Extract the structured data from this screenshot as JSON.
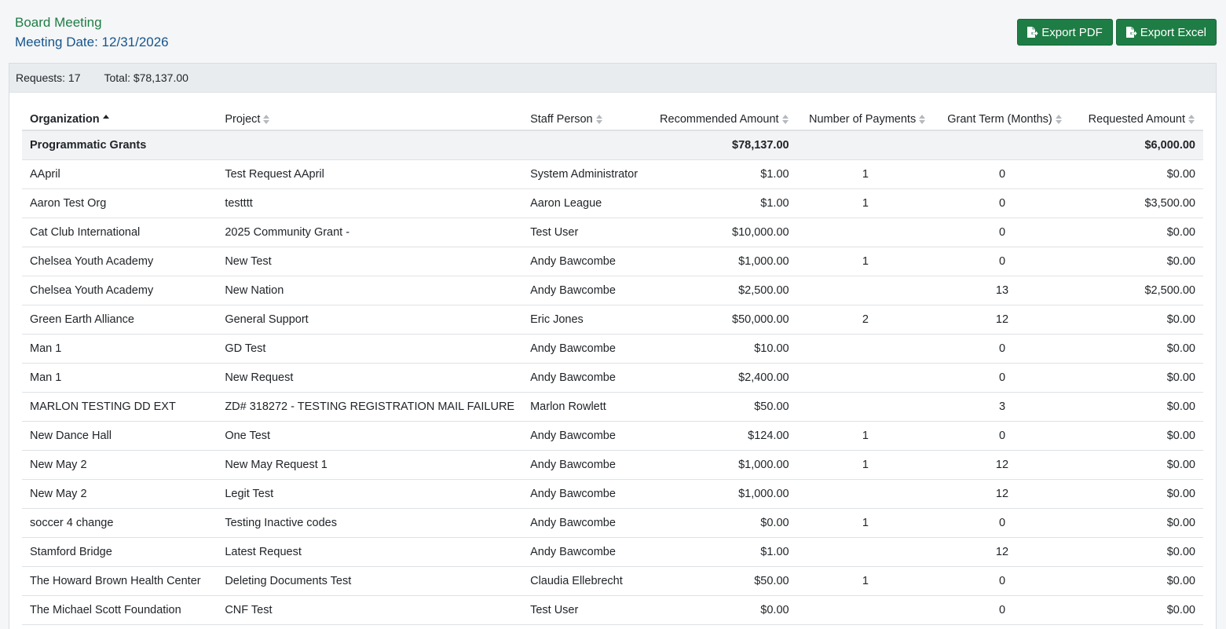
{
  "header": {
    "title": "Board Meeting",
    "meeting_date": "Meeting Date: 12/31/2026"
  },
  "toolbar": {
    "export_pdf": "Export PDF",
    "export_excel": "Export Excel"
  },
  "summary": {
    "requests": "Requests: 17",
    "total": "Total: $78,137.00"
  },
  "table": {
    "columns": [
      "Organization",
      "Project",
      "Staff Person",
      "Recommended Amount",
      "Number of Payments",
      "Grant Term (Months)",
      "Requested Amount"
    ],
    "group": {
      "label": "Programmatic Grants",
      "recommended_total": "$78,137.00",
      "requested_total": "$6,000.00"
    },
    "rows": [
      [
        "AApril",
        "Test Request AApril",
        "System Administrator",
        "$1.00",
        "1",
        "0",
        "$0.00"
      ],
      [
        "Aaron Test Org",
        "testttt",
        "Aaron League",
        "$1.00",
        "1",
        "0",
        "$3,500.00"
      ],
      [
        "Cat Club International",
        "2025 Community Grant -",
        "Test User",
        "$10,000.00",
        "",
        "0",
        "$0.00"
      ],
      [
        "Chelsea Youth Academy",
        "New Test",
        "Andy Bawcombe",
        "$1,000.00",
        "1",
        "0",
        "$0.00"
      ],
      [
        "Chelsea Youth Academy",
        "New Nation",
        "Andy Bawcombe",
        "$2,500.00",
        "",
        "13",
        "$2,500.00"
      ],
      [
        "Green Earth Alliance",
        "General Support",
        "Eric Jones",
        "$50,000.00",
        "2",
        "12",
        "$0.00"
      ],
      [
        "Man 1",
        "GD Test",
        "Andy Bawcombe",
        "$10.00",
        "",
        "0",
        "$0.00"
      ],
      [
        "Man 1",
        "New Request",
        "Andy Bawcombe",
        "$2,400.00",
        "",
        "0",
        "$0.00"
      ],
      [
        "MARLON TESTING DD EXT",
        "ZD# 318272 - TESTING REGISTRATION MAIL FAILURE",
        "Marlon Rowlett",
        "$50.00",
        "",
        "3",
        "$0.00"
      ],
      [
        "New Dance Hall",
        "One Test",
        "Andy Bawcombe",
        "$124.00",
        "1",
        "0",
        "$0.00"
      ],
      [
        "New May 2",
        "New May Request 1",
        "Andy Bawcombe",
        "$1,000.00",
        "1",
        "12",
        "$0.00"
      ],
      [
        "New May 2",
        "Legit Test",
        "Andy Bawcombe",
        "$1,000.00",
        "",
        "12",
        "$0.00"
      ],
      [
        "soccer 4 change",
        "Testing Inactive codes",
        "Andy Bawcombe",
        "$0.00",
        "1",
        "0",
        "$0.00"
      ],
      [
        "Stamford Bridge",
        "Latest Request",
        "Andy Bawcombe",
        "$1.00",
        "",
        "12",
        "$0.00"
      ],
      [
        "The Howard Brown Health Center",
        "Deleting Documents Test",
        "Claudia Ellebrecht",
        "$50.00",
        "1",
        "0",
        "$0.00"
      ],
      [
        "The Michael Scott Foundation",
        "CNF Test",
        "Test User",
        "$0.00",
        "",
        "0",
        "$0.00"
      ],
      [
        "",
        "",
        "",
        "",
        "",
        "",
        ""
      ]
    ]
  }
}
